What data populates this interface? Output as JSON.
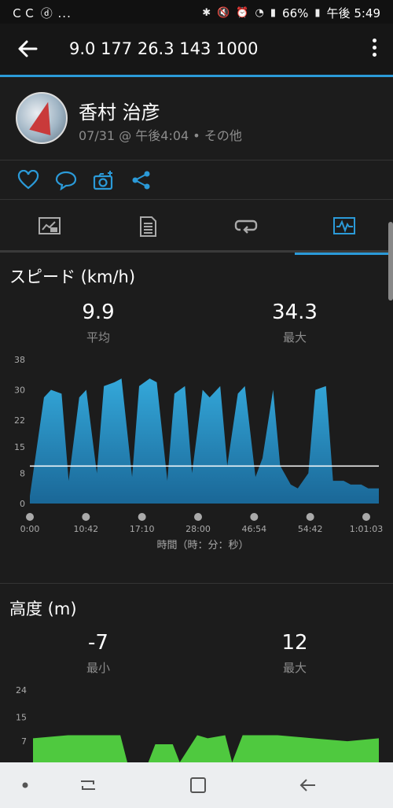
{
  "status_bar": {
    "left_icons": "ＣＣ ⓓ ...",
    "battery": "66%",
    "time": "午後 5:49"
  },
  "app_bar": {
    "title": "9.0  177   26.3  143  1000"
  },
  "profile": {
    "name": "香村 治彦",
    "meta": "07/31 @ 午後4:04 • その他"
  },
  "icons": {
    "back": "back-arrow-icon",
    "menu": "overflow-menu-icon",
    "like": "heart-icon",
    "comment": "comment-icon",
    "photo": "add-photo-icon",
    "share": "share-icon"
  },
  "tabs": [
    {
      "name": "summary",
      "icon": "summary-chart-icon",
      "active": false
    },
    {
      "name": "details",
      "icon": "document-icon",
      "active": false
    },
    {
      "name": "laps",
      "icon": "loop-icon",
      "active": false
    },
    {
      "name": "graphs",
      "icon": "graph-icon",
      "active": true
    }
  ],
  "speed": {
    "title": "スピード (km/h)",
    "avg_value": "9.9",
    "avg_label": "平均",
    "max_value": "34.3",
    "max_label": "最大"
  },
  "elevation": {
    "title": "高度 (m)",
    "min_value": "-7",
    "min_label": "最小",
    "max_value": "12",
    "max_label": "最大"
  },
  "colors": {
    "accent": "#2b9ad8",
    "speed_fill_top": "#34a8da",
    "speed_fill_bottom": "#1a6797",
    "elevation_fill": "#4fc93f",
    "avg_line": "#ffffff"
  },
  "chart_data": [
    {
      "type": "area",
      "title": "スピード (km/h)",
      "xlabel": "時間（時：分：秒）",
      "ylabel": "",
      "x_tick_labels": [
        "0:00",
        "10:42",
        "17:10",
        "28:00",
        "46:54",
        "54:42",
        "1:01:03"
      ],
      "y_ticks": [
        0,
        8,
        15,
        22,
        30,
        38
      ],
      "ylim": [
        0,
        38
      ],
      "average_line": 9.9,
      "x": [
        0,
        4,
        6,
        9,
        11,
        14,
        16,
        19,
        21,
        24,
        26,
        29,
        31,
        34,
        36,
        39,
        41,
        44,
        46,
        49,
        51,
        54,
        56,
        59,
        61,
        64,
        66,
        69,
        71,
        74,
        76,
        79,
        81,
        84,
        86,
        89,
        91,
        94,
        96,
        99
      ],
      "values": [
        2,
        28,
        30,
        29,
        6,
        28,
        30,
        8,
        31,
        32,
        33,
        7,
        31,
        33,
        32,
        6,
        29,
        31,
        8,
        30,
        28,
        31,
        10,
        29,
        31,
        7,
        12,
        30,
        10,
        5,
        4,
        8,
        30,
        31,
        6,
        6,
        5,
        5,
        4,
        4
      ],
      "series": [
        {
          "values_note_free": true
        }
      ]
    },
    {
      "type": "area",
      "title": "高度 (m)",
      "y_ticks": [
        7,
        15,
        24
      ],
      "ylim": [
        0,
        24
      ],
      "x": [
        0,
        10,
        20,
        25,
        27,
        33,
        35,
        40,
        42,
        47,
        50,
        55,
        57,
        60,
        70,
        80,
        90,
        99
      ],
      "values": [
        8,
        9,
        9,
        9,
        0,
        0,
        6,
        6,
        0,
        9,
        8,
        9,
        0,
        9,
        9,
        8,
        7,
        8
      ]
    }
  ]
}
